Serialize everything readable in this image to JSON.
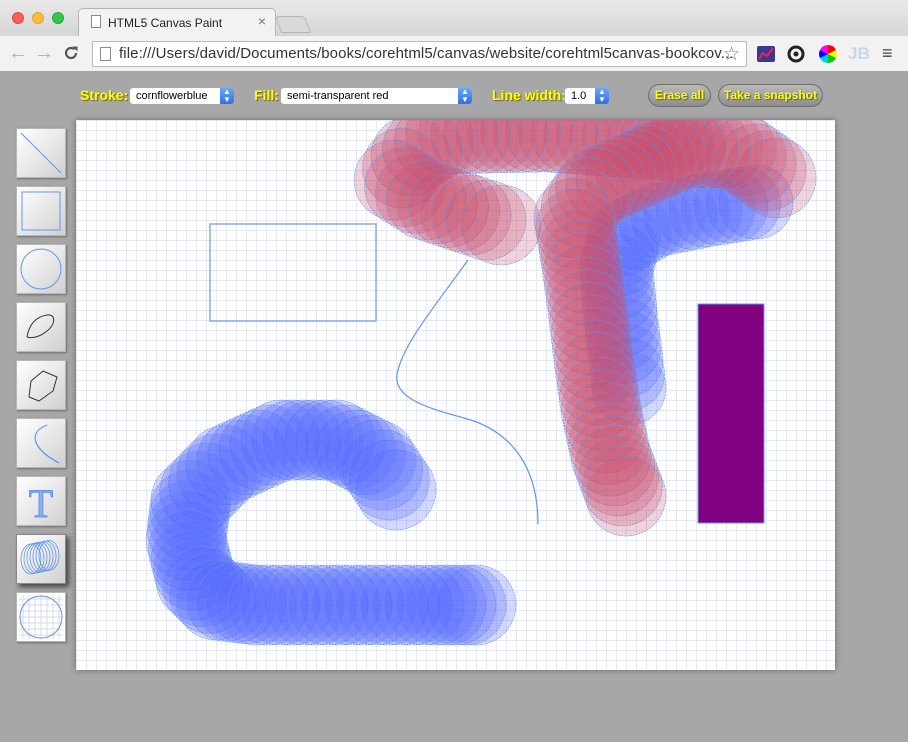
{
  "browser": {
    "tab_title": "HTML5 Canvas Paint",
    "tab_close": "×",
    "url": "file:///Users/david/Documents/books/corehtml5/canvas/website/corehtml5canvas-bookcov...",
    "back_glyph": "←",
    "forward_glyph": "→",
    "reload_glyph": "C",
    "star_glyph": "☆",
    "menu_glyph": "≡",
    "extension_jb": "JB"
  },
  "controls": {
    "stroke_label": "Stroke:",
    "stroke_value": "cornflowerblue",
    "fill_label": "Fill:",
    "fill_value": "semi-transparent red",
    "line_width_label": "Line width:",
    "line_width_value": "1.0",
    "erase_label": "Erase all",
    "snapshot_label": "Take a snapshot"
  },
  "tools": [
    {
      "name": "line",
      "icon": "line-icon",
      "active": false
    },
    {
      "name": "rectangle",
      "icon": "rectangle-icon",
      "active": false
    },
    {
      "name": "circle",
      "icon": "circle-icon",
      "active": false
    },
    {
      "name": "open-path",
      "icon": "open-path-icon",
      "active": false
    },
    {
      "name": "closed-path",
      "icon": "closed-path-icon",
      "active": false
    },
    {
      "name": "curve",
      "icon": "curve-icon",
      "active": false
    },
    {
      "name": "text",
      "icon": "text-icon",
      "label": "T",
      "active": false
    },
    {
      "name": "slinky",
      "icon": "slinky-icon",
      "active": true
    },
    {
      "name": "eraser",
      "icon": "eraser-icon",
      "active": false
    }
  ],
  "colors": {
    "stroke": "#6495ed",
    "fill_red": "rgba(200,80,110,0.25)",
    "fill_blue": "rgba(80,100,255,0.25)",
    "purple": "#800080",
    "label_yellow": "#ffff00"
  }
}
